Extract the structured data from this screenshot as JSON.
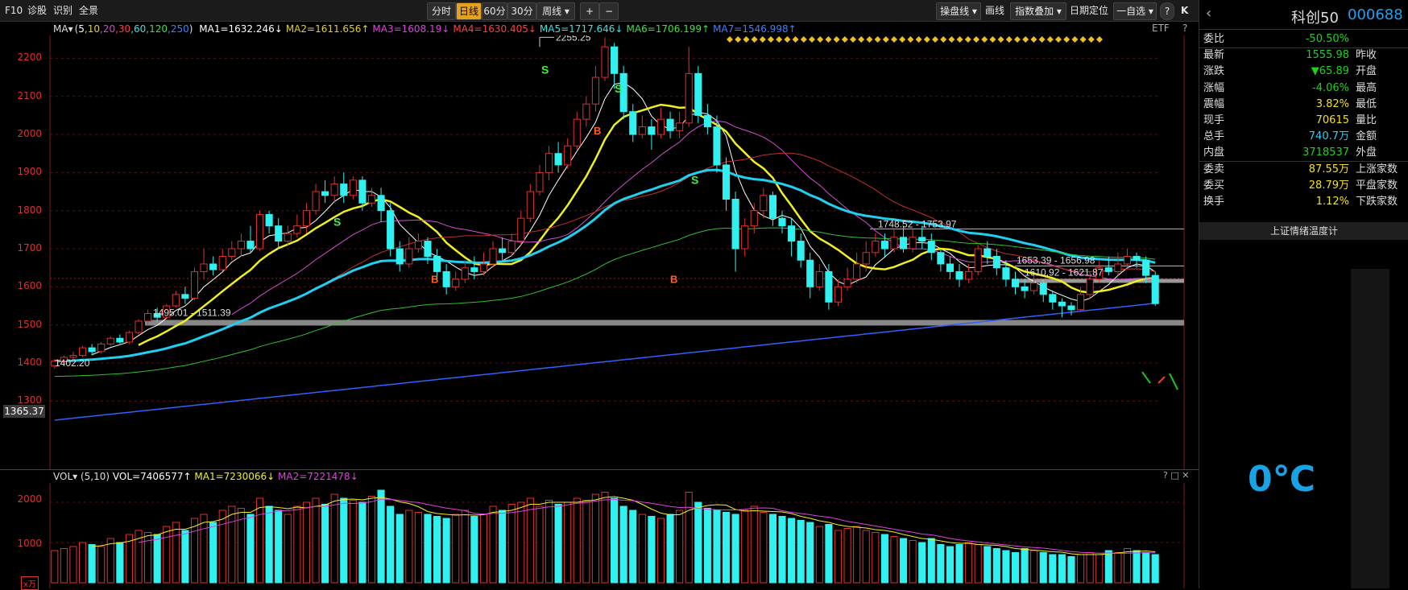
{
  "toolbar": {
    "f10": "F10",
    "diagnose": "诊股",
    "identify": "识别",
    "all_scenes": "全景",
    "periods": [
      "分时",
      "日线",
      "60分",
      "30分",
      "周线 ▾"
    ],
    "active_period": "日线",
    "zoom_in": "+",
    "zoom_out": "−",
    "right_items": [
      "操盘线 ▾",
      "画线",
      "指数叠加 ▾",
      "日期定位",
      "一自选 ▾"
    ]
  },
  "ma_legend": {
    "label": "MA▾",
    "params_open": "(",
    "params": [
      {
        "text": "5",
        "color": "#ffffff"
      },
      {
        "text": ",10",
        "color": "#e0d030"
      },
      {
        "text": ",20",
        "color": "#e040e0"
      },
      {
        "text": ",30",
        "color": "#ff4040"
      },
      {
        "text": ",60",
        "color": "#40e0e0"
      },
      {
        "text": ",120",
        "color": "#40e040"
      },
      {
        "text": ",250",
        "color": "#4080ff"
      }
    ],
    "params_close": ")",
    "values": [
      {
        "text": "MA1=1632.246↓",
        "color": "#ffffff"
      },
      {
        "text": "MA2=1611.656↑",
        "color": "#e0d030"
      },
      {
        "text": "MA3=1608.19↓",
        "color": "#e040e0"
      },
      {
        "text": "MA4=1630.405↓",
        "color": "#ff4040"
      },
      {
        "text": "MA5=1717.646↓",
        "color": "#40e0e0"
      },
      {
        "text": "MA6=1706.199↑",
        "color": "#40e040"
      },
      {
        "text": "MA7=1546.998↑",
        "color": "#4080ff"
      }
    ],
    "etf": "ETF",
    "help": "?"
  },
  "price_axis": {
    "ticks": [
      2200,
      2100,
      2000,
      1900,
      1800,
      1700,
      1600,
      1500,
      1400,
      1300
    ],
    "current_price_tag": "1365.37"
  },
  "annotations": {
    "high": "2255.25",
    "zone1": "1748.52 - 1753.97",
    "zone2": "1653.39 - 1656.98",
    "zone3": "1610.92 - 1621.87",
    "support": "1495.01 - 1511.39",
    "low_label": "1402.20",
    "signals": [
      "S",
      "S",
      "S",
      "S",
      "B",
      "B",
      "B"
    ]
  },
  "volume": {
    "label": "VOL▾",
    "params": "(5,10)",
    "vol_value": "VOL=7406577↑",
    "ma1": "MA1=7230066↓",
    "ma2": "MA2=7221478↓",
    "ticks": [
      "2000",
      "1000"
    ],
    "unit": "x万",
    "controls": "? □ ✕"
  },
  "panel": {
    "name": "科创50",
    "code": "000688",
    "rows_left": [
      {
        "k": "委比",
        "v": "-50.50%",
        "c": "#20d020",
        "k2": ""
      },
      {
        "k": "最新",
        "v": "1555.98",
        "c": "#20d020",
        "k2": "昨收"
      },
      {
        "k": "涨跌",
        "v": "▼65.89",
        "c": "#20d020",
        "k2": "开盘"
      },
      {
        "k": "涨幅",
        "v": "-4.06%",
        "c": "#20d020",
        "k2": "最高"
      },
      {
        "k": "震幅",
        "v": "3.82%",
        "c": "#f0e020",
        "k2": "最低"
      },
      {
        "k": "现手",
        "v": "70615",
        "c": "#f0e020",
        "k2": "量比"
      },
      {
        "k": "总手",
        "v": "740.7万",
        "c": "#3cc8f0",
        "k2": "金额"
      },
      {
        "k": "内盘",
        "v": "3718537",
        "c": "#20d020",
        "k2": "外盘"
      },
      {
        "k": "委卖",
        "v": "87.55万",
        "c": "#f0e020",
        "k2": "上涨家数"
      },
      {
        "k": "委买",
        "v": "28.79万",
        "c": "#f0e020",
        "k2": "平盘家数"
      },
      {
        "k": "换手",
        "v": "1.12%",
        "c": "#f0e020",
        "k2": "下跌家数"
      }
    ],
    "temp_title": "上证情绪温度计",
    "temp_value": "0℃"
  },
  "colors": {
    "up": "#e03030",
    "down": "#30f0f0",
    "ma5": "#ffffff",
    "ma10": "#f0f020",
    "ma20": "#d050d0",
    "ma30": "#c03030",
    "ma60": "#20d0f0",
    "ma120": "#30c030",
    "ma250": "#3060ff"
  },
  "chart_data": {
    "type": "candlestick",
    "ylim": [
      1250,
      2260
    ],
    "volume_ylim": [
      0,
      2400
    ],
    "candles": [
      [
        1392,
        1405,
        1385,
        1410
      ],
      [
        1405,
        1415,
        1400,
        1420
      ],
      [
        1415,
        1420,
        1405,
        1430
      ],
      [
        1420,
        1440,
        1415,
        1445
      ],
      [
        1440,
        1430,
        1420,
        1450
      ],
      [
        1430,
        1450,
        1425,
        1455
      ],
      [
        1450,
        1465,
        1445,
        1470
      ],
      [
        1465,
        1455,
        1450,
        1475
      ],
      [
        1455,
        1480,
        1450,
        1485
      ],
      [
        1480,
        1510,
        1475,
        1515
      ],
      [
        1510,
        1530,
        1500,
        1540
      ],
      [
        1530,
        1520,
        1510,
        1545
      ],
      [
        1520,
        1550,
        1515,
        1555
      ],
      [
        1550,
        1580,
        1545,
        1590
      ],
      [
        1580,
        1570,
        1555,
        1600
      ],
      [
        1570,
        1640,
        1565,
        1650
      ],
      [
        1640,
        1660,
        1620,
        1700
      ],
      [
        1660,
        1645,
        1630,
        1680
      ],
      [
        1645,
        1680,
        1640,
        1700
      ],
      [
        1680,
        1700,
        1670,
        1720
      ],
      [
        1700,
        1720,
        1680,
        1740
      ],
      [
        1720,
        1700,
        1690,
        1760
      ],
      [
        1700,
        1790,
        1695,
        1800
      ],
      [
        1790,
        1760,
        1740,
        1800
      ],
      [
        1760,
        1720,
        1700,
        1780
      ],
      [
        1720,
        1740,
        1710,
        1760
      ],
      [
        1740,
        1760,
        1730,
        1790
      ],
      [
        1760,
        1800,
        1740,
        1820
      ],
      [
        1800,
        1850,
        1790,
        1870
      ],
      [
        1850,
        1840,
        1820,
        1880
      ],
      [
        1840,
        1870,
        1820,
        1890
      ],
      [
        1870,
        1840,
        1820,
        1900
      ],
      [
        1840,
        1880,
        1830,
        1890
      ],
      [
        1880,
        1820,
        1800,
        1890
      ],
      [
        1820,
        1840,
        1810,
        1860
      ],
      [
        1840,
        1800,
        1770,
        1860
      ],
      [
        1800,
        1700,
        1680,
        1820
      ],
      [
        1700,
        1660,
        1640,
        1720
      ],
      [
        1660,
        1700,
        1650,
        1730
      ],
      [
        1700,
        1720,
        1690,
        1740
      ],
      [
        1720,
        1680,
        1660,
        1730
      ],
      [
        1680,
        1640,
        1620,
        1700
      ],
      [
        1640,
        1600,
        1580,
        1660
      ],
      [
        1600,
        1620,
        1590,
        1640
      ],
      [
        1620,
        1650,
        1610,
        1670
      ],
      [
        1650,
        1640,
        1620,
        1680
      ],
      [
        1640,
        1660,
        1630,
        1690
      ],
      [
        1660,
        1700,
        1650,
        1720
      ],
      [
        1700,
        1690,
        1670,
        1730
      ],
      [
        1690,
        1720,
        1680,
        1740
      ],
      [
        1720,
        1780,
        1710,
        1800
      ],
      [
        1780,
        1850,
        1770,
        1870
      ],
      [
        1850,
        1900,
        1840,
        1920
      ],
      [
        1900,
        1950,
        1880,
        1970
      ],
      [
        1950,
        1920,
        1900,
        1980
      ],
      [
        1920,
        1970,
        1910,
        1990
      ],
      [
        1970,
        2040,
        1960,
        2060
      ],
      [
        2040,
        2080,
        2020,
        2100
      ],
      [
        2080,
        2150,
        2060,
        2180
      ],
      [
        2150,
        2230,
        2140,
        2255
      ],
      [
        2230,
        2160,
        2120,
        2240
      ],
      [
        2160,
        2060,
        2040,
        2180
      ],
      [
        2060,
        2000,
        1980,
        2080
      ],
      [
        2000,
        2020,
        1990,
        2050
      ],
      [
        2020,
        2000,
        1960,
        2040
      ],
      [
        2000,
        2040,
        1990,
        2070
      ],
      [
        2040,
        2010,
        1990,
        2060
      ],
      [
        2010,
        2030,
        1990,
        2060
      ],
      [
        2030,
        2160,
        2020,
        2230
      ],
      [
        2160,
        2050,
        2030,
        2180
      ],
      [
        2050,
        2020,
        2000,
        2080
      ],
      [
        2020,
        1920,
        1900,
        2050
      ],
      [
        1920,
        1830,
        1800,
        1940
      ],
      [
        1830,
        1700,
        1640,
        1850
      ],
      [
        1700,
        1760,
        1680,
        1780
      ],
      [
        1760,
        1800,
        1740,
        1820
      ],
      [
        1800,
        1840,
        1780,
        1860
      ],
      [
        1840,
        1780,
        1760,
        1850
      ],
      [
        1780,
        1760,
        1740,
        1800
      ],
      [
        1760,
        1720,
        1680,
        1780
      ],
      [
        1720,
        1670,
        1650,
        1740
      ],
      [
        1670,
        1600,
        1570,
        1690
      ],
      [
        1600,
        1640,
        1590,
        1660
      ],
      [
        1640,
        1560,
        1540,
        1660
      ],
      [
        1560,
        1600,
        1550,
        1620
      ],
      [
        1600,
        1620,
        1590,
        1650
      ],
      [
        1620,
        1660,
        1610,
        1690
      ],
      [
        1660,
        1690,
        1640,
        1720
      ],
      [
        1690,
        1720,
        1680,
        1740
      ],
      [
        1720,
        1700,
        1680,
        1740
      ],
      [
        1700,
        1730,
        1690,
        1750
      ],
      [
        1730,
        1700,
        1690,
        1760
      ],
      [
        1700,
        1730,
        1690,
        1750
      ],
      [
        1730,
        1720,
        1700,
        1760
      ],
      [
        1720,
        1690,
        1670,
        1740
      ],
      [
        1690,
        1660,
        1640,
        1700
      ],
      [
        1660,
        1640,
        1620,
        1680
      ],
      [
        1640,
        1620,
        1600,
        1660
      ],
      [
        1620,
        1640,
        1610,
        1660
      ],
      [
        1640,
        1700,
        1630,
        1710
      ],
      [
        1700,
        1680,
        1660,
        1720
      ],
      [
        1680,
        1650,
        1630,
        1700
      ],
      [
        1650,
        1620,
        1600,
        1670
      ],
      [
        1620,
        1600,
        1580,
        1640
      ],
      [
        1600,
        1590,
        1570,
        1620
      ],
      [
        1590,
        1610,
        1580,
        1630
      ],
      [
        1610,
        1580,
        1560,
        1620
      ],
      [
        1580,
        1560,
        1540,
        1590
      ],
      [
        1560,
        1550,
        1520,
        1570
      ],
      [
        1550,
        1540,
        1525,
        1560
      ],
      [
        1540,
        1580,
        1535,
        1600
      ],
      [
        1580,
        1620,
        1570,
        1640
      ],
      [
        1620,
        1650,
        1610,
        1670
      ],
      [
        1650,
        1640,
        1630,
        1680
      ],
      [
        1640,
        1660,
        1630,
        1690
      ],
      [
        1660,
        1680,
        1650,
        1700
      ],
      [
        1680,
        1670,
        1650,
        1690
      ],
      [
        1670,
        1630,
        1610,
        1680
      ],
      [
        1630,
        1556,
        1550,
        1640
      ]
    ],
    "volumes": [
      800,
      850,
      900,
      1000,
      950,
      900,
      1100,
      1000,
      1200,
      1300,
      1250,
      1200,
      1400,
      1500,
      1300,
      1600,
      1700,
      1500,
      1800,
      1900,
      1850,
      1700,
      2100,
      1900,
      1800,
      1700,
      1900,
      2000,
      2100,
      1950,
      2200,
      2100,
      2050,
      2000,
      2150,
      2300,
      1900,
      1700,
      1800,
      1750,
      1700,
      1650,
      1600,
      1700,
      1800,
      1650,
      1700,
      1900,
      1800,
      1950,
      2000,
      2100,
      1900,
      2050,
      1950,
      2000,
      2100,
      2050,
      2200,
      2250,
      2100,
      1900,
      1800,
      1700,
      1650,
      1600,
      1700,
      1800,
      2250,
      2000,
      1850,
      1800,
      1750,
      1700,
      1800,
      1900,
      1750,
      1700,
      1650,
      1600,
      1550,
      1500,
      1400,
      1450,
      1300,
      1350,
      1400,
      1300,
      1250,
      1200,
      1150,
      1100,
      1050,
      1000,
      1100,
      950,
      900,
      950,
      1000,
      950,
      900,
      850,
      800,
      750,
      850,
      800,
      750,
      700,
      700,
      650,
      700,
      750,
      700,
      800,
      750,
      850,
      800,
      750,
      700
    ]
  }
}
